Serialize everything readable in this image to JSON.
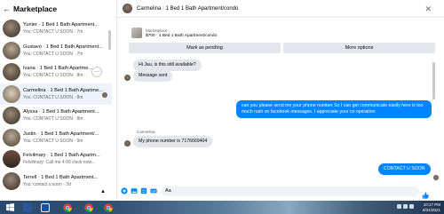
{
  "left_panel": {
    "title": "Marketplace",
    "conversations": [
      {
        "name": "Yunier · 1 Bed 1 Bath Apartment...",
        "snippet": "You: CONTACT U SOON · 7m",
        "active": false
      },
      {
        "name": "Gustavo · 1 Bed 1 Bath Apartment...",
        "snippet": "You: CONTACT U SOON · 7m",
        "active": false
      },
      {
        "name": "Ivana · 1 Bed 1 Bath Apartme...",
        "snippet": "You: CONTACT U SOON · 8m",
        "active": false
      },
      {
        "name": "Carmelina · 1 Bed 1 Bath Apartme...",
        "snippet": "You: CONTACT U SOON · 8m",
        "active": true
      },
      {
        "name": "Alyssa · 1 Bed 1 Bath Apartment...",
        "snippet": "You: CONTACT U SOON · 8m",
        "active": false
      },
      {
        "name": "Justin · 1 Bed 1 Bath Apartment/...",
        "snippet": "You: CONTACT U SOON · 9m",
        "active": false
      },
      {
        "name": "Felvilmary · 1 Bed 1 Bath Apartm...",
        "snippet": "Felvilmary: Call me 4:00 clock now...",
        "active": false
      },
      {
        "name": "Terrell · 1 Bed 1 Bath Apartment...",
        "snippet": "You: contact u soon · 3d",
        "active": false
      }
    ],
    "more_glyph": "···",
    "footer_glyph": "▲"
  },
  "chat": {
    "title": "Carmelina · 1 Bed 1 Bath Apartment/condo",
    "close_glyph": "✕",
    "listing_label": "Marketplace",
    "listing_title": "$700 · 1 Bed 1 Bath Apartment/condo",
    "actions": {
      "mark_pending": "Mark as pending",
      "more_options": "More options"
    },
    "messages": [
      {
        "text": "Hi Jau, is this still available?",
        "direction": "in"
      },
      {
        "text": "Message sent",
        "direction": "in"
      },
      {
        "text": "can you please send me your phone number So I can get communicate easily here is too much rush on facebook messages. I appreciate your co operation",
        "direction": "out"
      },
      {
        "sender": "Carmelina"
      },
      {
        "text": "My phone number is 7176669404",
        "direction": "in"
      },
      {
        "text": "CONTACT U SOON",
        "direction": "out"
      }
    ],
    "composer_text": "Aa",
    "icons": [
      "plus-icon",
      "photo-icon",
      "sticker-icon",
      "gif-icon",
      "thumbs-up-icon"
    ]
  },
  "taskbar": {
    "time": "10:17 PM",
    "date": "8/31/2021",
    "apps": [
      "windows",
      "word",
      "chrome",
      "chrome",
      "chrome"
    ]
  }
}
